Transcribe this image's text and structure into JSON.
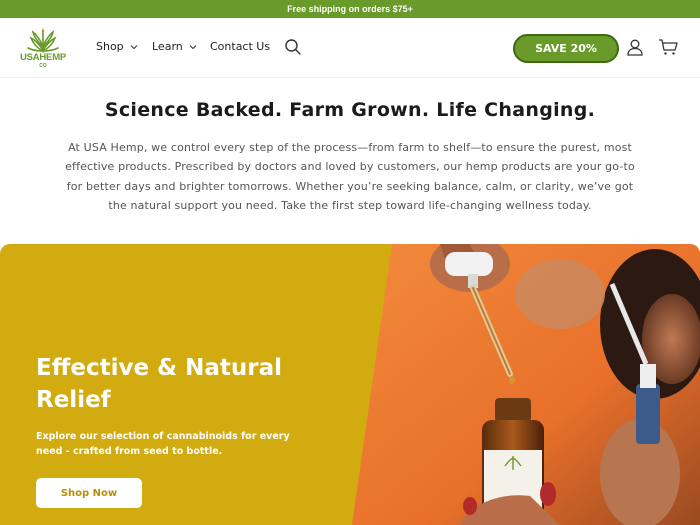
{
  "announcement": {
    "text": "Free shipping on orders $75+"
  },
  "brand": {
    "logo_word": "USAHEMP",
    "logo_sub": "CO",
    "accent": "#6a9a2a",
    "dark_accent": "#3f6a14"
  },
  "nav": {
    "items": [
      {
        "label": "Shop",
        "has_dropdown": true
      },
      {
        "label": "Learn",
        "has_dropdown": true
      },
      {
        "label": "Contact Us",
        "has_dropdown": false
      }
    ],
    "icons": [
      "search-icon",
      "account-icon",
      "cart-icon"
    ]
  },
  "header": {
    "save_label": "SAVE 20%"
  },
  "intro": {
    "title": "Science Backed. Farm Grown. Life Changing.",
    "body": "At USA Hemp, we control every step of the process—from farm to shelf—to ensure the purest, most effective products. Prescribed by doctors and loved by customers, our hemp products are your go-to for better days and brighter tomorrows. Whether you’re seeking balance, calm, or clarity, we’ve got the natural support you need. Take the first step toward life-changing wellness today."
  },
  "hero": {
    "title": "Effective & Natural Relief",
    "subtitle": "Explore our selection of cannabinoids for every need - crafted from seed to bottle.",
    "button_label": "Shop Now",
    "panel_color": "#d1ab10"
  }
}
